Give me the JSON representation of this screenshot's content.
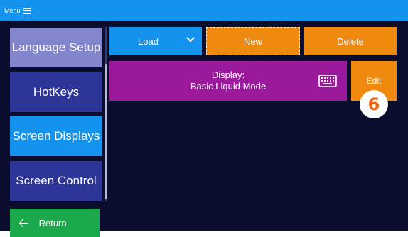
{
  "topbar": {
    "menu_label": "Menu",
    "menu_icon": "hamburger-icon"
  },
  "sidebar": {
    "items": [
      {
        "label": "Language Setup"
      },
      {
        "label": "HotKeys"
      },
      {
        "label": "Screen Displays",
        "selected": true
      },
      {
        "label": "Screen Control"
      }
    ],
    "return_label": "Return",
    "return_icon": "arrow-left-icon"
  },
  "toolbar": {
    "load_label": "Load",
    "new_label": "New",
    "delete_label": "Delete"
  },
  "display_card": {
    "line1": "Display:",
    "line2": "Basic Liquid Mode",
    "icon": "keyboard-icon"
  },
  "edit_label": "Edit",
  "step_badge": "6",
  "colors": {
    "topbar": "#1493ee",
    "background": "#0b0d2e",
    "orange": "#ef8a0f",
    "purple": "#9a1a9b",
    "green": "#1aa84a",
    "badge_text": "#f06414"
  }
}
